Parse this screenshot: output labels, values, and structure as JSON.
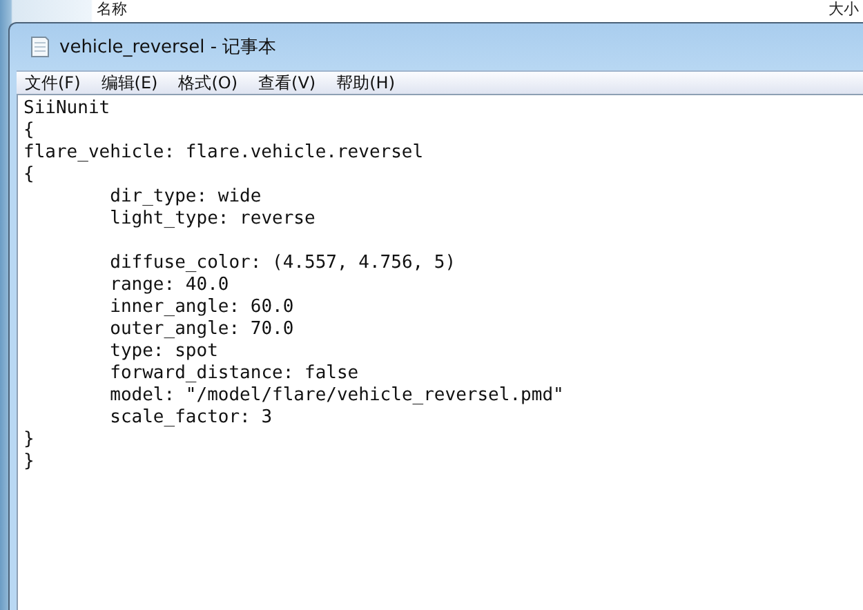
{
  "background_window": {
    "columns": [
      "名称",
      "大小"
    ]
  },
  "window": {
    "title": "vehicle_reversel - 记事本"
  },
  "menu": [
    "文件(F)",
    "编辑(E)",
    "格式(O)",
    "查看(V)",
    "帮助(H)"
  ],
  "editor": {
    "text": "SiiNunit\n{\nflare_vehicle: flare.vehicle.reversel\n{\n\tdir_type: wide\n\tlight_type: reverse\n\n\tdiffuse_color: (4.557, 4.756, 5)\n\trange: 40.0\n\tinner_angle: 60.0\n\touter_angle: 70.0\n\ttype: spot\n\tforward_distance: false\n\tmodel: \"/model/flare/vehicle_reversel.pmd\"\n\tscale_factor: 3\n}\n}"
  }
}
